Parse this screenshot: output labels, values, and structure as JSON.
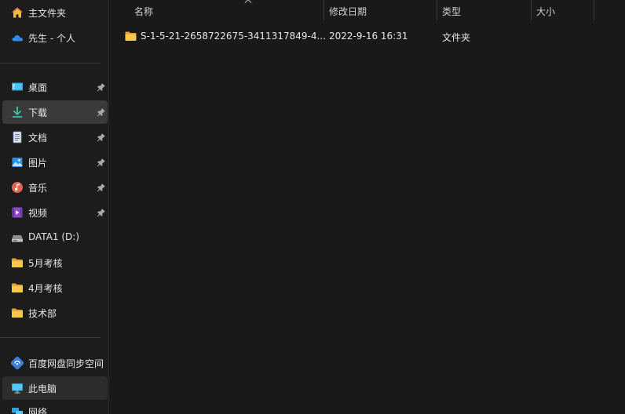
{
  "sidebar": {
    "top_items": [
      {
        "label": "主文件夹",
        "icon": "home-icon"
      },
      {
        "label": "先生 - 个人",
        "icon": "onedrive-cloud-icon"
      }
    ],
    "pinned_items": [
      {
        "label": "桌面",
        "icon": "desktop-icon",
        "pinned": true
      },
      {
        "label": "下载",
        "icon": "download-icon",
        "pinned": true,
        "selected": true
      },
      {
        "label": "文档",
        "icon": "document-icon",
        "pinned": true
      },
      {
        "label": "图片",
        "icon": "pictures-icon",
        "pinned": true
      },
      {
        "label": "音乐",
        "icon": "music-icon",
        "pinned": true
      },
      {
        "label": "视频",
        "icon": "video-icon",
        "pinned": true
      },
      {
        "label": "DATA1 (D:)",
        "icon": "drive-icon",
        "pinned": false
      },
      {
        "label": "5月考核",
        "icon": "folder-icon",
        "pinned": false
      },
      {
        "label": "4月考核",
        "icon": "folder-icon",
        "pinned": false
      },
      {
        "label": "技术部",
        "icon": "folder-icon",
        "pinned": false
      }
    ],
    "bottom_items": [
      {
        "label": "百度网盘同步空间",
        "icon": "baidu-netdisk-icon"
      },
      {
        "label": "此电脑",
        "icon": "this-pc-icon",
        "hover": true
      },
      {
        "label": "网络",
        "icon": "network-icon"
      }
    ]
  },
  "columns": {
    "name": "名称",
    "modified": "修改日期",
    "type": "类型",
    "size": "大小"
  },
  "files": [
    {
      "name": "S-1-5-21-2658722675-3411317849-4...",
      "modified": "2022-9-16 16:31",
      "type": "文件夹",
      "size": "",
      "icon": "folder-icon"
    }
  ],
  "colors": {
    "background": "#191919",
    "sidebar_bg": "#1c1c1c",
    "selected_bg": "#3a3a3a",
    "folder_yellow": "#f4c13d",
    "text": "#e6e6e6"
  }
}
